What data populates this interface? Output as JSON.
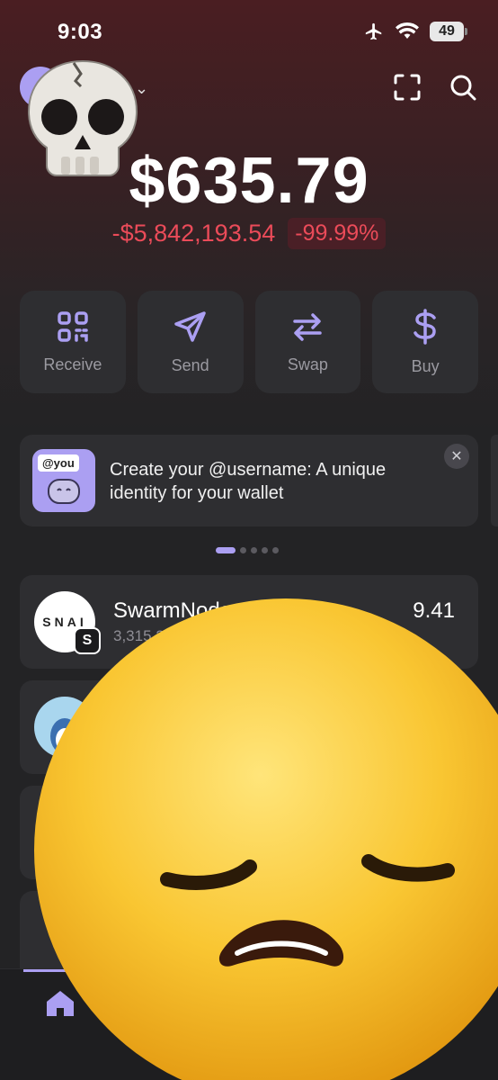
{
  "status_bar": {
    "time": "9:03",
    "battery": "49"
  },
  "header": {
    "chevron": "⌄"
  },
  "balance": {
    "total": "$635.79",
    "change_abs": "-$5,842,193.54",
    "change_pct": "-99.99%"
  },
  "actions": [
    {
      "label": "Receive",
      "icon": "qr-code-icon"
    },
    {
      "label": "Send",
      "icon": "send-icon"
    },
    {
      "label": "Swap",
      "icon": "swap-icon"
    },
    {
      "label": "Buy",
      "icon": "dollar-icon"
    }
  ],
  "banner": {
    "tag": "@you",
    "text": "Create your @username: A unique identity for your wallet",
    "close": "✕"
  },
  "tokens": [
    {
      "logo_text": "SNAI",
      "badge": "S",
      "name": "SwarmNode",
      "amount": "3,315.2",
      "value": "9.41"
    }
  ],
  "colors": {
    "accent": "#ab9ff2",
    "negative": "#eb4b59",
    "card": "#2e2e31"
  }
}
